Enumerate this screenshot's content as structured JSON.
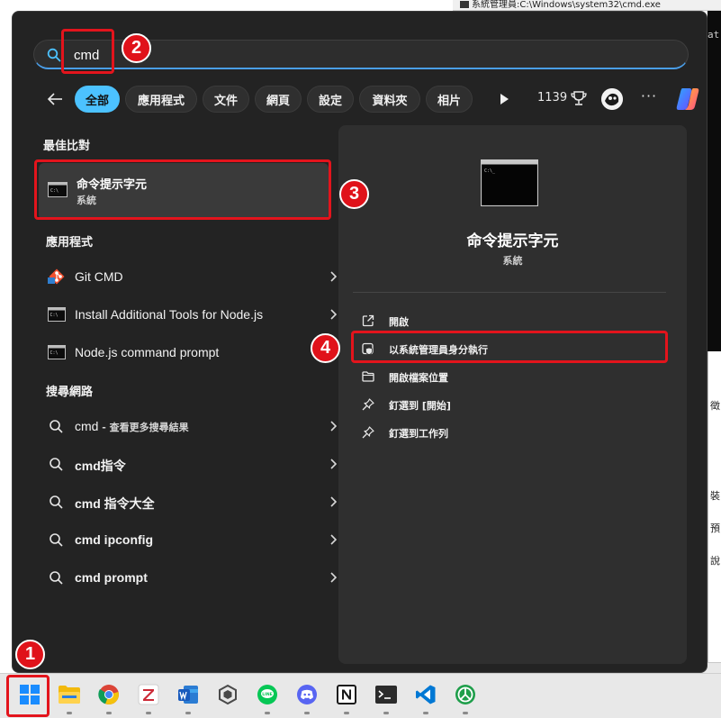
{
  "background": {
    "top_window_title": "系統管理員:C:\\Windows\\system32\\cmd.exe",
    "console_text": "at",
    "side_texts": [
      "徵",
      "裝",
      "預",
      "說"
    ]
  },
  "search": {
    "query": "cmd",
    "placeholder": ""
  },
  "filters": {
    "back_label": "←",
    "chips": [
      "全部",
      "應用程式",
      "文件",
      "網頁",
      "設定",
      "資料夾",
      "相片"
    ],
    "active_chip": "全部",
    "points": "1139",
    "more_label": "···"
  },
  "left": {
    "best_match_heading": "最佳比對",
    "best_match": {
      "title": "命令提示字元",
      "subtitle": "系統"
    },
    "apps_heading": "應用程式",
    "apps": [
      {
        "label": "Git CMD",
        "icon": "git-icon"
      },
      {
        "label": "Install Additional Tools for Node.js",
        "icon": "cmd-icon"
      },
      {
        "label": "Node.js command prompt",
        "icon": "cmd-icon"
      }
    ],
    "web_heading": "搜尋網路",
    "web": [
      {
        "main": "cmd",
        "extra": " - 查看更多搜尋結果"
      },
      {
        "main": "cmd指令",
        "extra": ""
      },
      {
        "main": "cmd 指令大全",
        "extra": ""
      },
      {
        "main": "cmd ipconfig",
        "extra": ""
      },
      {
        "main": "cmd prompt",
        "extra": ""
      }
    ]
  },
  "detail": {
    "title": "命令提示字元",
    "subtitle": "系統",
    "actions": [
      {
        "label": "開啟",
        "icon": "open-external-icon"
      },
      {
        "label": "以系統管理員身分執行",
        "icon": "shield-admin-icon"
      },
      {
        "label": "開啟檔案位置",
        "icon": "folder-icon"
      },
      {
        "label": "釘選到 [開始]",
        "icon": "pin-icon"
      },
      {
        "label": "釘選到工作列",
        "icon": "pin-icon"
      }
    ]
  },
  "annotations": [
    "1",
    "2",
    "3",
    "4"
  ],
  "taskbar": {
    "apps": [
      "windows-start-icon",
      "file-explorer-icon",
      "chrome-icon",
      "zotero-icon",
      "word-icon",
      "unity-icon",
      "line-icon",
      "discord-icon",
      "notion-icon",
      "terminal-icon",
      "vscode-icon",
      "app-icon"
    ]
  },
  "colors": {
    "accent": "#4cc2ff",
    "highlight_red": "#e3141c",
    "menu_bg": "#232323",
    "panel_bg": "#2f2f2f"
  }
}
